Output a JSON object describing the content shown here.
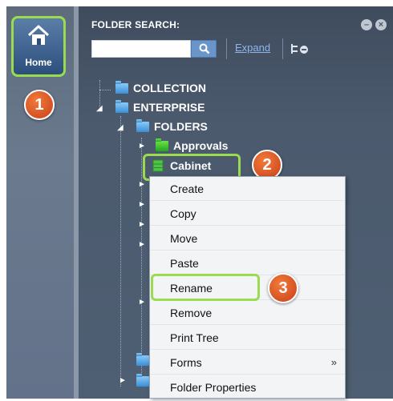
{
  "sidebar": {
    "home_label": "Home",
    "badges": [
      "1",
      "2",
      "3"
    ]
  },
  "search": {
    "label": "FOLDER SEARCH:",
    "value": "",
    "expand_label": "Expand"
  },
  "tree": {
    "nodes": [
      {
        "label": "COLLECTION",
        "icon": "blue-folder-icon"
      },
      {
        "label": "ENTERPRISE",
        "icon": "blue-folder-icon"
      },
      {
        "label": "FOLDERS",
        "icon": "blue-folder-icon"
      },
      {
        "label": "Approvals",
        "icon": "green-folder-icon"
      },
      {
        "label": "Cabinet",
        "icon": "green-cabinet-icon"
      }
    ]
  },
  "context_menu": {
    "items": [
      "Create",
      "Copy",
      "Move",
      "Paste",
      "Rename",
      "Remove",
      "Print Tree",
      "Forms",
      "Folder Properties"
    ],
    "submenu_indicator": "»"
  },
  "colors": {
    "highlight": "#9adb4f",
    "badge": "#e2582a",
    "panel": "#4b5a6d"
  }
}
